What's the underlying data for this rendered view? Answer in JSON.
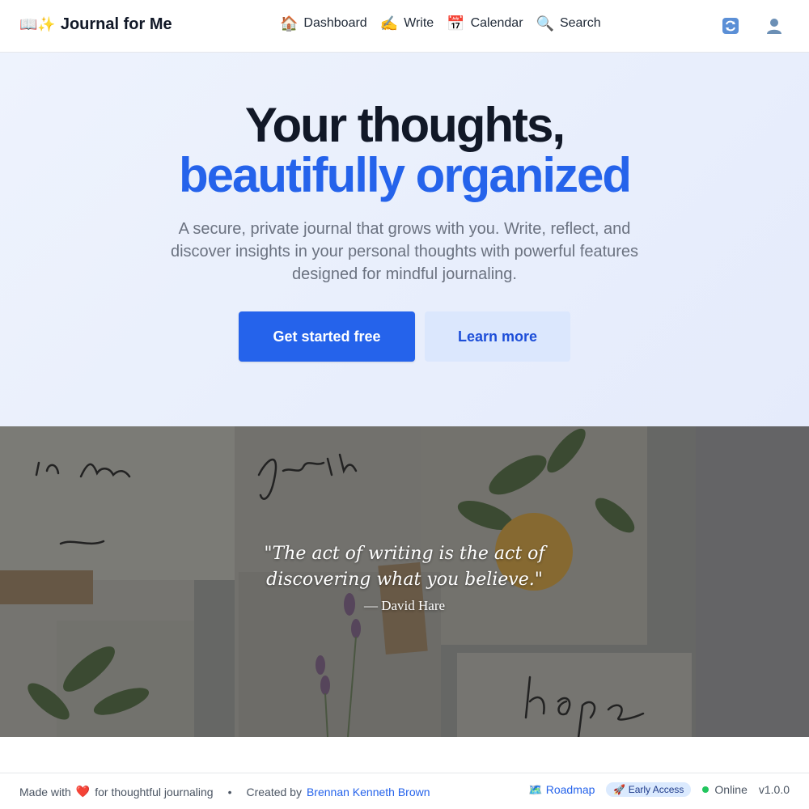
{
  "header": {
    "brand_emoji": "📖✨",
    "brand_title": "Journal for Me",
    "nav": [
      {
        "icon": "🏠",
        "label": "Dashboard"
      },
      {
        "icon": "✍️",
        "label": "Write"
      },
      {
        "icon": "📅",
        "label": "Calendar"
      },
      {
        "icon": "🔍",
        "label": "Search"
      }
    ],
    "sync_icon": "sync-icon",
    "user_icon": "user-icon"
  },
  "hero": {
    "title_line1": "Your thoughts,",
    "title_line2": "beautifully organized",
    "subtitle": "A secure, private journal that grows with you. Write, reflect, and discover insights in your personal thoughts with powerful features designed for mindful journaling.",
    "primary_button": "Get started free",
    "secondary_button": "Learn more"
  },
  "quote": {
    "text": "\"The act of writing is the act of discovering what you believe.\"",
    "author": "— David Hare"
  },
  "footer": {
    "made_with": "Made with",
    "heart": "❤️",
    "for_text": "for thoughtful journaling",
    "separator": "•",
    "created_by": "Created by",
    "author_link": "Brennan Kenneth Brown",
    "roadmap_icon": "🗺️",
    "roadmap": "Roadmap",
    "early_access": "🚀 Early Access",
    "status": "Online",
    "version": "v1.0.0"
  },
  "colors": {
    "accent": "#2563eb",
    "status_online": "#22c55e"
  }
}
